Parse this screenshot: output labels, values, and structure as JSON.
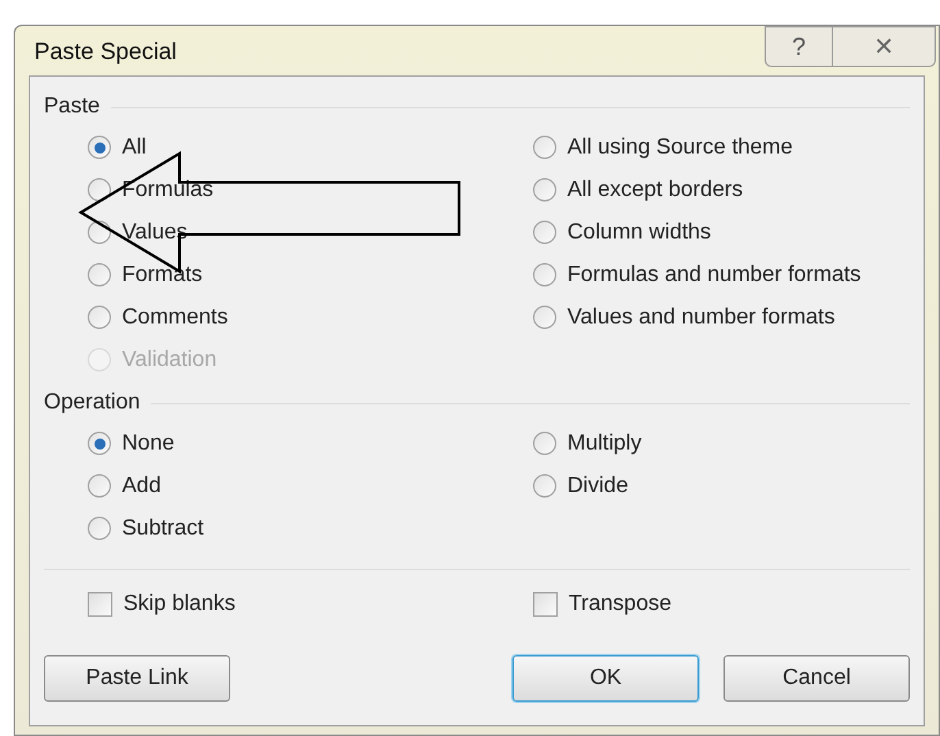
{
  "window": {
    "title": "Paste Special",
    "help": "?",
    "close": "✕"
  },
  "paste": {
    "title": "Paste",
    "left": [
      {
        "label": "All",
        "selected": true,
        "disabled": false
      },
      {
        "label": "Formulas",
        "selected": false,
        "disabled": false
      },
      {
        "label": "Values",
        "selected": false,
        "disabled": false
      },
      {
        "label": "Formats",
        "selected": false,
        "disabled": false
      },
      {
        "label": "Comments",
        "selected": false,
        "disabled": false
      },
      {
        "label": "Validation",
        "selected": false,
        "disabled": true
      }
    ],
    "right": [
      {
        "label": "All using Source theme",
        "selected": false,
        "disabled": false
      },
      {
        "label": "All except borders",
        "selected": false,
        "disabled": false
      },
      {
        "label": "Column widths",
        "selected": false,
        "disabled": false
      },
      {
        "label": "Formulas and number formats",
        "selected": false,
        "disabled": false
      },
      {
        "label": "Values and number formats",
        "selected": false,
        "disabled": false
      }
    ]
  },
  "operation": {
    "title": "Operation",
    "left": [
      {
        "label": "None",
        "selected": true,
        "disabled": false
      },
      {
        "label": "Add",
        "selected": false,
        "disabled": false
      },
      {
        "label": "Subtract",
        "selected": false,
        "disabled": false
      }
    ],
    "right": [
      {
        "label": "Multiply",
        "selected": false,
        "disabled": false
      },
      {
        "label": "Divide",
        "selected": false,
        "disabled": false
      }
    ]
  },
  "options": [
    {
      "label": "Skip blanks",
      "checked": false
    },
    {
      "label": "Transpose",
      "checked": false
    }
  ],
  "buttons": [
    {
      "label": "Paste Link",
      "default": false
    },
    {
      "label": "OK",
      "default": true
    },
    {
      "label": "Cancel",
      "default": false
    }
  ]
}
